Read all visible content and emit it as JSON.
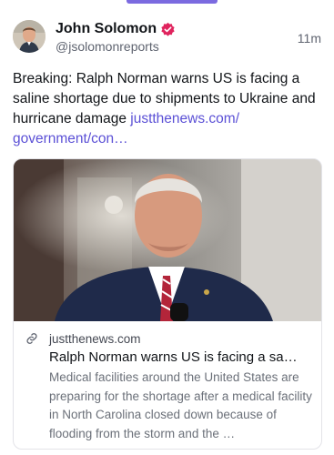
{
  "tweet": {
    "author_name": "John Solomon",
    "author_handle": "@jsolomonreports",
    "time": "11m",
    "text": "Breaking: Ralph Norman warns US is facing a saline shortage due to shipments to Ukraine and hurricane damage ",
    "link_text": "justthenews.com/\ngovernment/con…"
  },
  "card": {
    "domain": "justthenews.com",
    "title": "Ralph Norman warns US is facing a sa…",
    "description": "Medical facilities around the United States are preparing for the shortage after a medical facility in North Carolina closed down because of flooding from the storm and the …"
  },
  "colors": {
    "accent": "#7b6ae0",
    "link": "#5b50d6",
    "verified_badge": "#e0245e",
    "muted_text": "#6b7079"
  },
  "icons": {
    "verified": "verified-badge-icon",
    "link": "link-icon"
  }
}
